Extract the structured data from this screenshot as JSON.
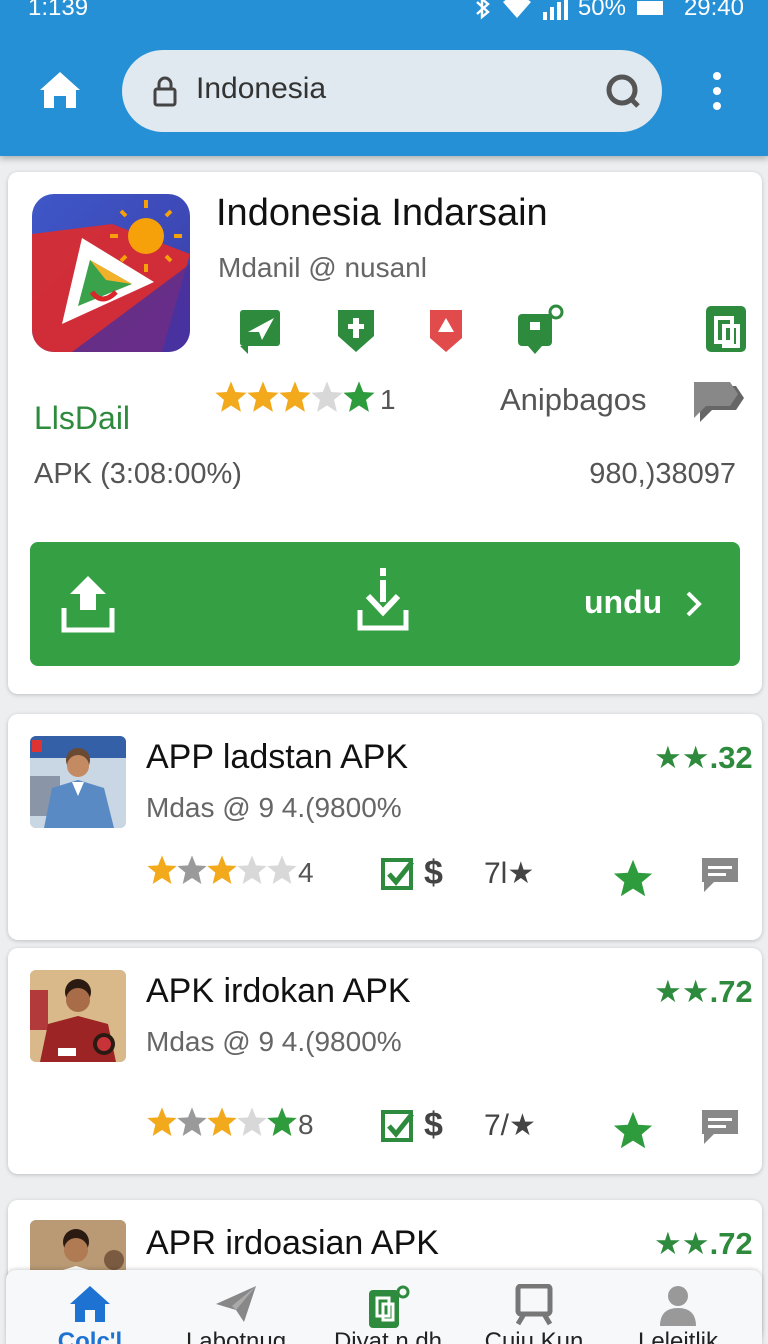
{
  "status_bar": {
    "time_left": "1:139",
    "battery": "50%",
    "time_right": "29:40",
    "icons": [
      "bluetooth-icon",
      "wifi-icon",
      "signal-icon",
      "battery-icon"
    ]
  },
  "header": {
    "home_icon": "home-icon",
    "search_query": "Indonesia",
    "menu_icon": "more-vert-icon",
    "colors": {
      "bar": "#2590d6",
      "search_bg": "#dfe9ef"
    }
  },
  "featured": {
    "title": "Indonesia Indarsain",
    "subtitle": "Mdanil @ nusanl",
    "rating_stars": 3.5,
    "rating_count": "1",
    "category": "Anipbagos",
    "developer": "LlsDail",
    "apk_info": "APK (3:08:00%)",
    "downloads": "980,)38097",
    "action_icons": [
      "send-icon",
      "shield-icon",
      "pin-icon",
      "badge-icon",
      "document-icon"
    ],
    "download_label": "undu",
    "accent": "#34a043"
  },
  "apps": [
    {
      "title": "APP ladstan APK",
      "subtitle": "Mdas @ 9 4.(9800%",
      "price": "★★.32",
      "rating_stars": 3,
      "rating_count": "4",
      "count_label": "7l★"
    },
    {
      "title": "APK irdokan APK",
      "subtitle": "Mdas @ 9 4.(9800%",
      "price": "★★.72",
      "rating_stars": 3.5,
      "rating_count": "8",
      "count_label": "7/★"
    },
    {
      "title": "APR irdoasian APK",
      "subtitle": "",
      "price": "★★.72"
    }
  ],
  "bottom_nav": [
    {
      "label": "Colc'l",
      "icon": "home-icon",
      "active": true
    },
    {
      "label": "Labotnug",
      "icon": "send-icon",
      "active": false
    },
    {
      "label": "Diyat n dh",
      "icon": "document-icon",
      "active": false
    },
    {
      "label": "Cuiu Kun",
      "icon": "tram-icon",
      "active": false
    },
    {
      "label": "Leleitlik",
      "icon": "person-icon",
      "active": false
    }
  ]
}
